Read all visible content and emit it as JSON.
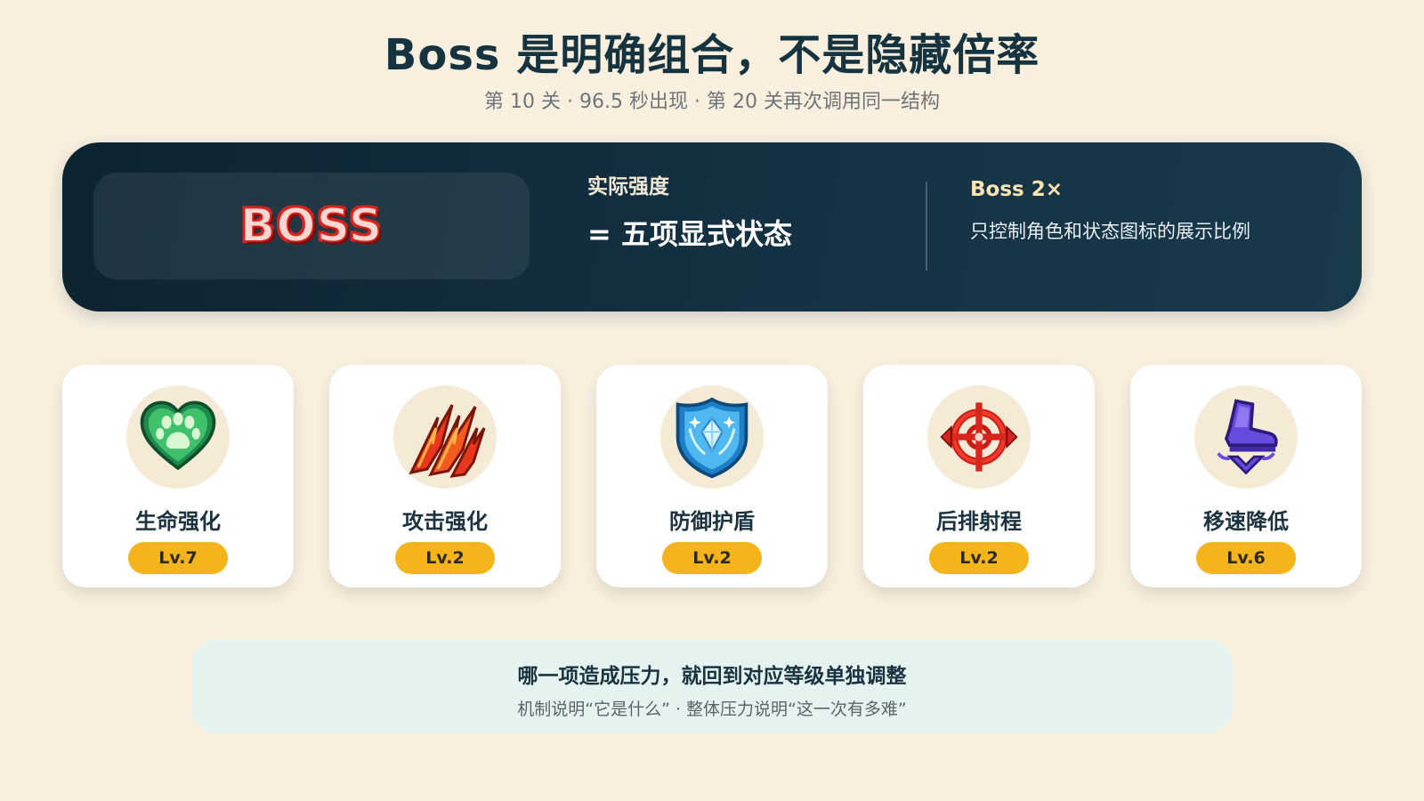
{
  "header": {
    "title": "Boss 是明确组合，不是隐藏倍率",
    "subtitle": "第 10 关 · 96.5 秒出现 · 第 20 关再次调用同一结构"
  },
  "hero": {
    "badge": "BOSS",
    "strength_label": "实际强度",
    "strength_value": "= 五项显式状态",
    "scale_title": "Boss 2×",
    "scale_desc": "只控制角色和状态图标的展示比例"
  },
  "cards": [
    {
      "name": "生命强化",
      "level": "Lv.7",
      "icon": "green-heart-paw-icon"
    },
    {
      "name": "攻击强化",
      "level": "Lv.2",
      "icon": "red-claw-slash-icon"
    },
    {
      "name": "防御护盾",
      "level": "Lv.2",
      "icon": "blue-crystal-shield-icon"
    },
    {
      "name": "后排射程",
      "level": "Lv.2",
      "icon": "red-crosshair-icon"
    },
    {
      "name": "移速降低",
      "level": "Lv.6",
      "icon": "purple-boot-down-icon"
    }
  ],
  "note": {
    "title": "哪一项造成压力，就回到对应等级单独调整",
    "desc": "机制说明“它是什么” · 整体压力说明“这一次有多难”"
  },
  "colors": {
    "background": "#f8efdf",
    "hero": "#143243",
    "level_badge": "#f5b41c",
    "note_bg": "#e4f3ef"
  }
}
